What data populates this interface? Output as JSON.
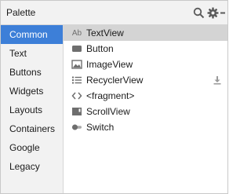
{
  "header": {
    "title": "Palette"
  },
  "icons": {
    "search": "search-icon",
    "settings": "gear-icon",
    "minimize": "minimize-icon"
  },
  "categories": [
    {
      "label": "Common",
      "active": true
    },
    {
      "label": "Text"
    },
    {
      "label": "Buttons"
    },
    {
      "label": "Widgets"
    },
    {
      "label": "Layouts"
    },
    {
      "label": "Containers"
    },
    {
      "label": "Google"
    },
    {
      "label": "Legacy"
    }
  ],
  "items": [
    {
      "label": "TextView",
      "icon": "text-view-icon",
      "icon_text": "Ab",
      "selected": true
    },
    {
      "label": "Button",
      "icon": "button-icon"
    },
    {
      "label": "ImageView",
      "icon": "image-icon"
    },
    {
      "label": "RecyclerView",
      "icon": "list-icon",
      "download": true
    },
    {
      "label": "<fragment>",
      "icon": "fragment-icon",
      "icon_text": "<>"
    },
    {
      "label": "ScrollView",
      "icon": "scroll-view-icon"
    },
    {
      "label": "Switch",
      "icon": "switch-icon"
    }
  ],
  "colors": {
    "accent": "#3d7fd8",
    "selected_row": "#d4d4d4",
    "icon": "#6e6e6e"
  }
}
